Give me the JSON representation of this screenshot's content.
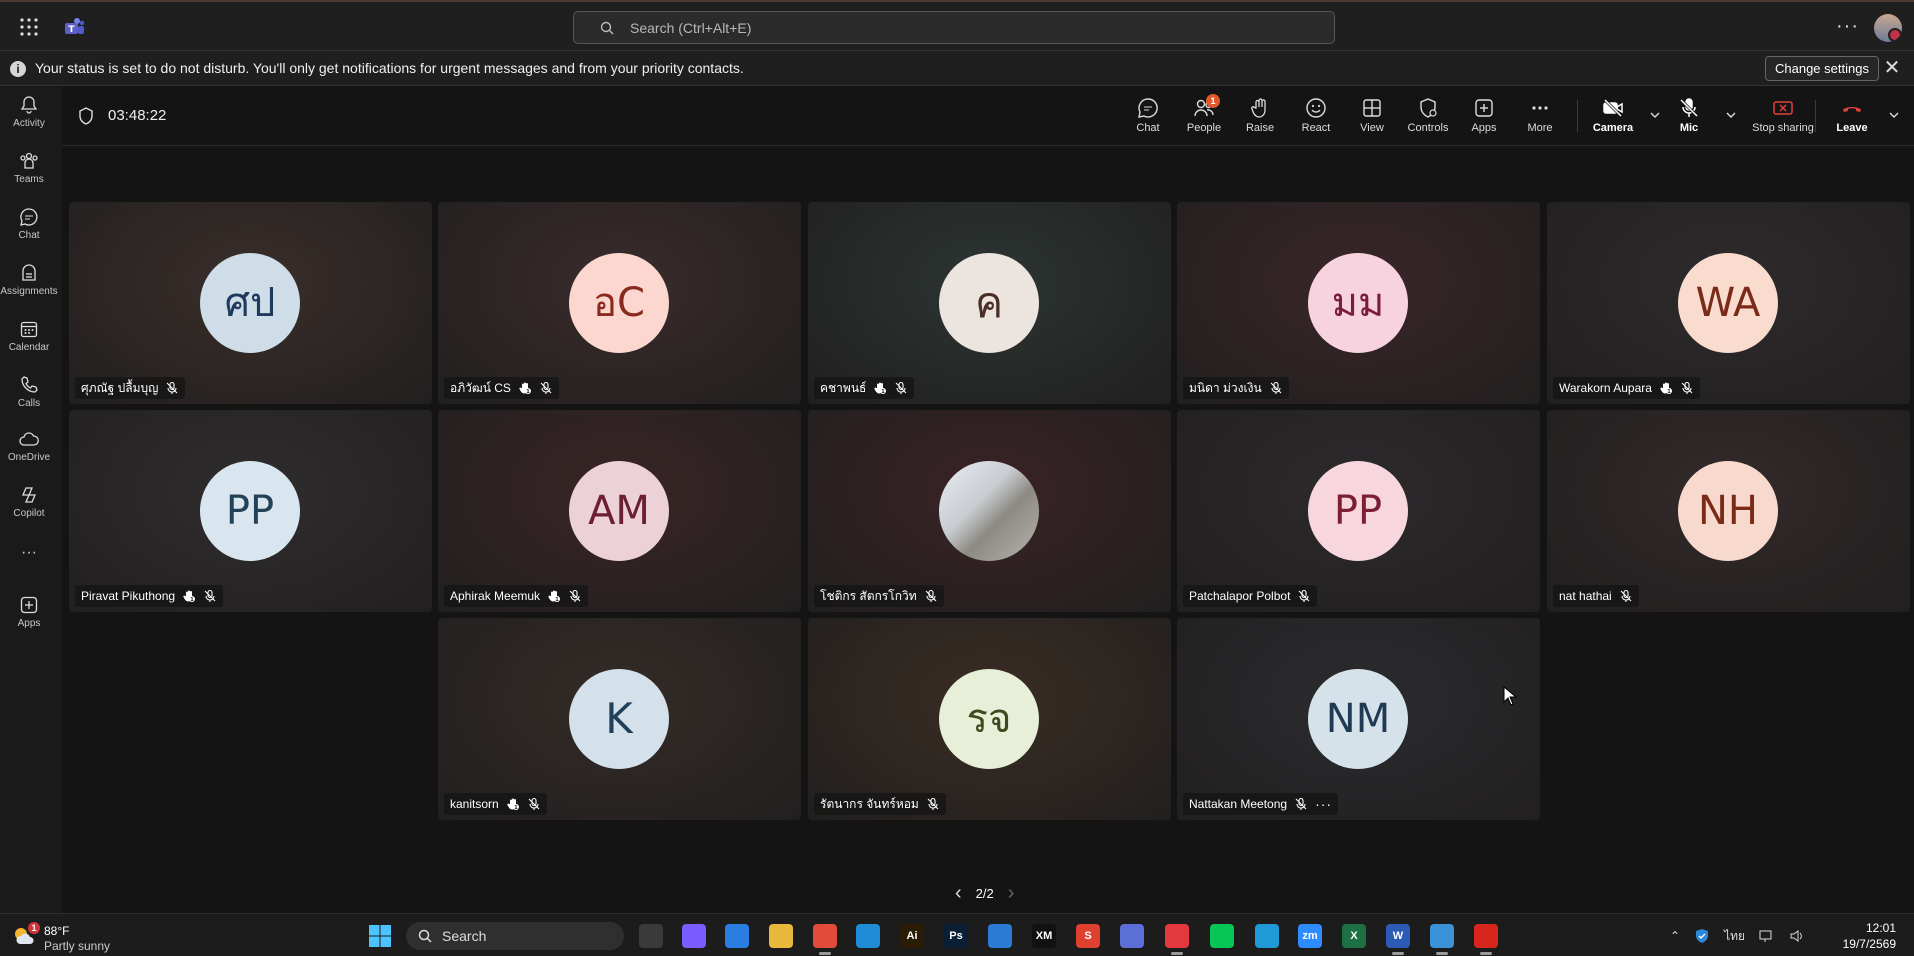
{
  "titlebar": {
    "search_placeholder": "Search (Ctrl+Alt+E)",
    "more_label": "···"
  },
  "banner": {
    "text": "Your status is set to do not disturb. You'll only get notifications for urgent messages and from your priority contacts.",
    "change_settings": "Change settings",
    "info_glyph": "i",
    "close_glyph": "✕"
  },
  "rail": {
    "items": [
      {
        "label": "Activity",
        "icon": "bell-icon"
      },
      {
        "label": "Teams",
        "icon": "teams-icon"
      },
      {
        "label": "Chat",
        "icon": "chat-icon"
      },
      {
        "label": "Assignments",
        "icon": "assignments-icon"
      },
      {
        "label": "Calendar",
        "icon": "calendar-icon"
      },
      {
        "label": "Calls",
        "icon": "phone-icon"
      },
      {
        "label": "OneDrive",
        "icon": "cloud-icon"
      },
      {
        "label": "Copilot",
        "icon": "copilot-icon"
      },
      {
        "label": "Apps",
        "icon": "apps-add-icon"
      }
    ],
    "more_glyph": "···"
  },
  "meeting": {
    "timer": "03:48:22",
    "toolbar": {
      "chat": "Chat",
      "people": "People",
      "people_badge": "1",
      "raise": "Raise",
      "react": "React",
      "view": "View",
      "controls": "Controls",
      "apps": "Apps",
      "more": "More",
      "camera": "Camera",
      "mic": "Mic",
      "stop_sharing": "Stop sharing",
      "leave": "Leave"
    },
    "participants": [
      {
        "initials": "ศป",
        "name": "ศุภณัฐ ปลื้มบุญ",
        "bg": "#cfdde9",
        "fg": "#1e3a5c",
        "hand": false
      },
      {
        "initials": "อC",
        "name": "อภิวัฒน์ CS",
        "bg": "#fbd7cf",
        "fg": "#8a2a1e",
        "hand": true
      },
      {
        "initials": "ค",
        "name": "คชาพนธ์",
        "bg": "#ece4de",
        "fg": "#4a2f28",
        "hand": true
      },
      {
        "initials": "มม",
        "name": "มนิดา ม่วงเงิน",
        "bg": "#f7d3df",
        "fg": "#7a1d3b",
        "hand": false
      },
      {
        "initials": "WA",
        "name": "Warakorn Aupara",
        "bg": "#fadccf",
        "fg": "#7a2a18",
        "hand": true
      },
      {
        "initials": "PP",
        "name": "Piravat Pikuthong",
        "bg": "#d9e6ef",
        "fg": "#234258",
        "hand": true
      },
      {
        "initials": "AM",
        "name": "Aphirak Meemuk",
        "bg": "#ecd2d8",
        "fg": "#6b1f31",
        "hand": true
      },
      {
        "initials": "",
        "name": "โชติกร สัตกรโกวิท",
        "bg": "#b8bcc0",
        "fg": "#333",
        "hand": false,
        "photo": true
      },
      {
        "initials": "PP",
        "name": "Patchalapor Polbot",
        "bg": "#f7d6dd",
        "fg": "#7c1f34",
        "hand": false
      },
      {
        "initials": "NH",
        "name": "nat hathai",
        "bg": "#f8d9cd",
        "fg": "#7a2a16",
        "hand": false
      },
      {
        "initials": "K",
        "name": "kanitsorn",
        "bg": "#d4e0ea",
        "fg": "#23405a",
        "hand": true
      },
      {
        "initials": "รจ",
        "name": "รัตนากร จันทร์หอม",
        "bg": "#e8efd9",
        "fg": "#3d4a1e",
        "hand": false
      },
      {
        "initials": "NM",
        "name": "Nattakan Meetong",
        "bg": "#d6e2ea",
        "fg": "#1f3a52",
        "hand": false,
        "more": true
      }
    ],
    "pager": "2/2",
    "pager_prev": "‹",
    "pager_next": "›"
  },
  "taskbar": {
    "weather_temp": "88°F",
    "weather_desc": "Partly sunny",
    "weather_badge": "1",
    "search_label": "Search",
    "lang": "ไทย",
    "time": "12:01",
    "date": "19/7/2569",
    "apps": [
      {
        "name": "task-view",
        "color": "#3a3a3a",
        "glyph": ""
      },
      {
        "name": "copilot",
        "color": "#7b5cff",
        "glyph": ""
      },
      {
        "name": "store",
        "color": "#2a7de1",
        "glyph": ""
      },
      {
        "name": "file-explorer",
        "color": "#e8b83c",
        "glyph": ""
      },
      {
        "name": "chrome",
        "color": "#e24a3b",
        "glyph": ""
      },
      {
        "name": "vscode",
        "color": "#1f8ad6",
        "glyph": ""
      },
      {
        "name": "illustrator",
        "color": "#2b1d05",
        "glyph": "Ai"
      },
      {
        "name": "photoshop",
        "color": "#0a1e36",
        "glyph": "Ps"
      },
      {
        "name": "calendar",
        "color": "#2b7bd6",
        "glyph": ""
      },
      {
        "name": "xm",
        "color": "#111111",
        "glyph": "XM"
      },
      {
        "name": "snagit",
        "color": "#e0402e",
        "glyph": "S"
      },
      {
        "name": "app-blue",
        "color": "#5b6fd6",
        "glyph": ""
      },
      {
        "name": "anydesk",
        "color": "#e3383e",
        "glyph": ""
      },
      {
        "name": "line",
        "color": "#06c755",
        "glyph": ""
      },
      {
        "name": "edge",
        "color": "#1f9ad6",
        "glyph": ""
      },
      {
        "name": "zoom",
        "color": "#2d8cff",
        "glyph": "zm"
      },
      {
        "name": "excel",
        "color": "#1d7044",
        "glyph": "X"
      },
      {
        "name": "word",
        "color": "#2b5bb5",
        "glyph": "W"
      },
      {
        "name": "photos",
        "color": "#3a92d8",
        "glyph": ""
      },
      {
        "name": "acrobat",
        "color": "#d9261c",
        "glyph": ""
      }
    ]
  }
}
